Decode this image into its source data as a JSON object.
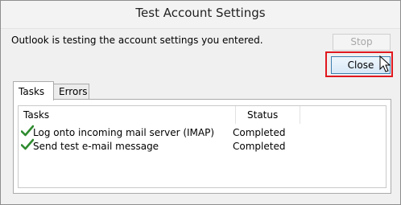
{
  "window": {
    "title": "Test Account Settings"
  },
  "message": "Outlook is testing the account settings you entered.",
  "buttons": {
    "stop": "Stop",
    "close": "Close"
  },
  "tabs": [
    {
      "label": "Tasks",
      "selected": true
    },
    {
      "label": "Errors",
      "selected": false
    }
  ],
  "table": {
    "headers": {
      "tasks": "Tasks",
      "status": "Status"
    },
    "rows": [
      {
        "icon": "check-icon",
        "task": "Log onto incoming mail server (IMAP)",
        "status": "Completed"
      },
      {
        "icon": "check-icon",
        "task": "Send test e-mail message",
        "status": "Completed"
      }
    ]
  },
  "colors": {
    "highlight": "#e0181e",
    "check": "#2e8b2e",
    "close_border": "#3c7fb1"
  }
}
